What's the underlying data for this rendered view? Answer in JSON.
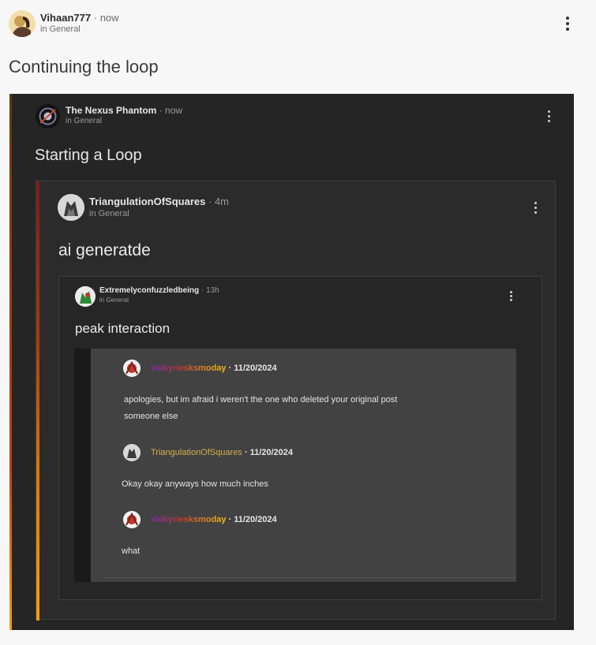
{
  "post": {
    "author": "Vihaan777",
    "separator": "·",
    "time": "now",
    "subforum": "in General",
    "title": "Continuing the loop"
  },
  "shot1": {
    "author": "The Nexus Phantom",
    "separator": "·",
    "time": "now",
    "subforum": "in General",
    "title": "Starting a Loop"
  },
  "shot2": {
    "author": "TriangulationOfSquares",
    "separator": "·",
    "time": "4m",
    "subforum": "in General",
    "title": "ai generatde"
  },
  "shot3": {
    "author": "Extremelyconfuzzledbeing",
    "separator": "·",
    "time": "13h",
    "subforum": "in General",
    "title": "peak interaction"
  },
  "chat": {
    "messages": [
      {
        "author": "Valkyriesksmoday",
        "date": "11/20/2024",
        "lines": [
          "apologies, but im afraid i weren't the one who deleted your original post",
          "someone else"
        ]
      },
      {
        "author": "TriangulationOfSquares",
        "date": "11/20/2024",
        "lines": [
          "Okay okay anyways how much inches"
        ]
      },
      {
        "author": "Valkyriesksmoday",
        "date": "11/20/2024",
        "lines": [
          "what"
        ]
      }
    ]
  },
  "colors": {
    "page_bg": "#f7f7f8",
    "dark_bg": "#252525",
    "chat_bg": "#424242",
    "accent_gold": "#d4b04a"
  },
  "icons": [
    "kebab-menu-icon",
    "avatar"
  ]
}
